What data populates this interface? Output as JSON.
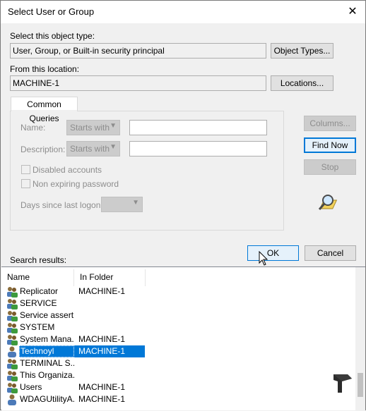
{
  "window": {
    "title": "Select User or Group"
  },
  "object_type": {
    "label": "Select this object type:",
    "value": "User, Group, or Built-in security principal",
    "button": "Object Types..."
  },
  "location": {
    "label": "From this location:",
    "value": "MACHINE-1",
    "button": "Locations..."
  },
  "queries": {
    "tab": "Common Queries",
    "name_label": "Name:",
    "name_mode": "Starts with",
    "description_label": "Description:",
    "description_mode": "Starts with",
    "disabled_label": "Disabled accounts",
    "nonexpiring_label": "Non expiring password",
    "days_label": "Days since last logon:"
  },
  "side_buttons": {
    "columns": "Columns...",
    "find_now": "Find Now",
    "stop": "Stop"
  },
  "actions": {
    "ok": "OK",
    "cancel": "Cancel"
  },
  "results": {
    "label": "Search results:",
    "columns": [
      "Name",
      "In Folder"
    ],
    "rows": [
      {
        "name": "Replicator",
        "folder": "MACHINE-1",
        "icon": "group-icon"
      },
      {
        "name": "SERVICE",
        "folder": "",
        "icon": "group-icon"
      },
      {
        "name": "Service assert...",
        "folder": "",
        "icon": "group-icon"
      },
      {
        "name": "SYSTEM",
        "folder": "",
        "icon": "group-icon"
      },
      {
        "name": "System Mana...",
        "folder": "MACHINE-1",
        "icon": "group-icon"
      },
      {
        "name": "Technoyl",
        "folder": "MACHINE-1",
        "icon": "user-icon",
        "selected": true
      },
      {
        "name": "TERMINAL S...",
        "folder": "",
        "icon": "group-icon"
      },
      {
        "name": "This Organiza...",
        "folder": "",
        "icon": "group-icon"
      },
      {
        "name": "Users",
        "folder": "MACHINE-1",
        "icon": "group-icon"
      },
      {
        "name": "WDAGUtilityA...",
        "folder": "MACHINE-1",
        "icon": "user-icon"
      }
    ]
  },
  "colors": {
    "selection": "#0078d7",
    "accent": "#0078d7"
  }
}
